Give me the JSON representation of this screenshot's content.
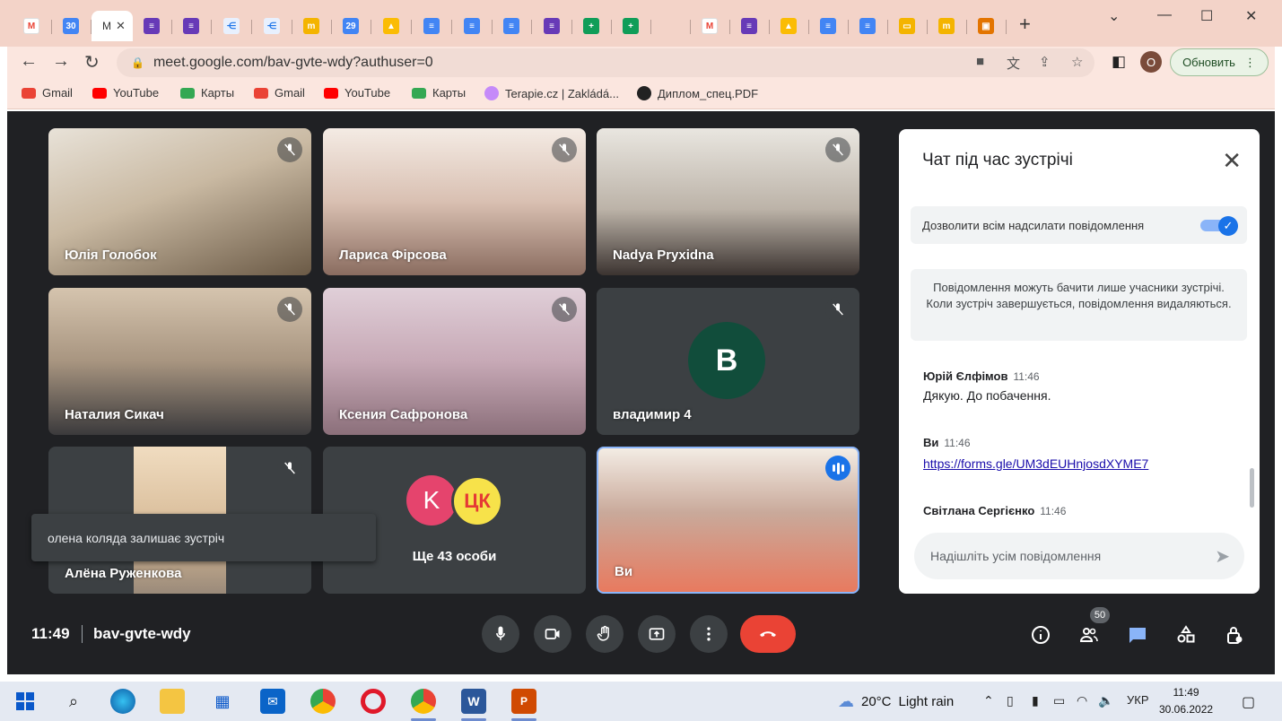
{
  "browser": {
    "active_tab_text": "M",
    "url": "meet.google.com/bav-gvte-wdy?authuser=0",
    "profile_initial": "O",
    "update_label": "Обновить",
    "bookmarks": [
      "Gmail",
      "YouTube",
      "Карты",
      "Gmail",
      "YouTube",
      "Карты",
      "Terapie.cz | Zakládá...",
      "Диплом_спец.PDF"
    ]
  },
  "participants": [
    {
      "name": "Юлія Голобок",
      "muted": true
    },
    {
      "name": "Лариса Фірсова",
      "muted": true
    },
    {
      "name": "Nadya Pryxidna",
      "muted": true
    },
    {
      "name": "Наталия Сикач",
      "muted": true
    },
    {
      "name": "Ксения Сафронова",
      "muted": true
    },
    {
      "name": "владимир 4",
      "muted": true,
      "avatar_letter": "B"
    },
    {
      "name": "Алёна Руженкова",
      "muted": true
    },
    {
      "name": "Ще 43 особи",
      "avatar_letter": "K",
      "avatar2_text": "ЦК"
    },
    {
      "name": "Ви",
      "speaking": true
    }
  ],
  "toast": "олена коляда залишає зустріч",
  "chat": {
    "title": "Чат під час зустрічі",
    "allow_label": "Дозволити всім надсилати повідомлення",
    "allow_on": true,
    "notice": "Повідомлення можуть бачити лише учасники зустрічі. Коли зустріч завершується, повідомлення видаляються.",
    "messages": [
      {
        "author": "Юрій Єлфімов",
        "time": "11:46",
        "text": "Дякую. До побачення."
      },
      {
        "author": "Ви",
        "time": "11:46",
        "link": "https://forms.gle/UM3dEUHnjosdXYME7"
      },
      {
        "author": "Світлана Сергієнко",
        "time": "11:46"
      }
    ],
    "input_placeholder": "Надішліть усім повідомлення"
  },
  "meeting": {
    "time": "11:49",
    "code": "bav-gvte-wdy",
    "people_count": "50"
  },
  "taskbar": {
    "temperature": "20°C",
    "weather": "Light rain",
    "lang": "УКР",
    "time": "11:49",
    "date": "30.06.2022"
  },
  "colors": {
    "meet_bg": "#202124",
    "tile_bg": "#3c4043",
    "end_call": "#ea4335",
    "accent": "#1a73e8",
    "avatar_green": "#114d3b",
    "avatar_pink": "#e5446d"
  }
}
